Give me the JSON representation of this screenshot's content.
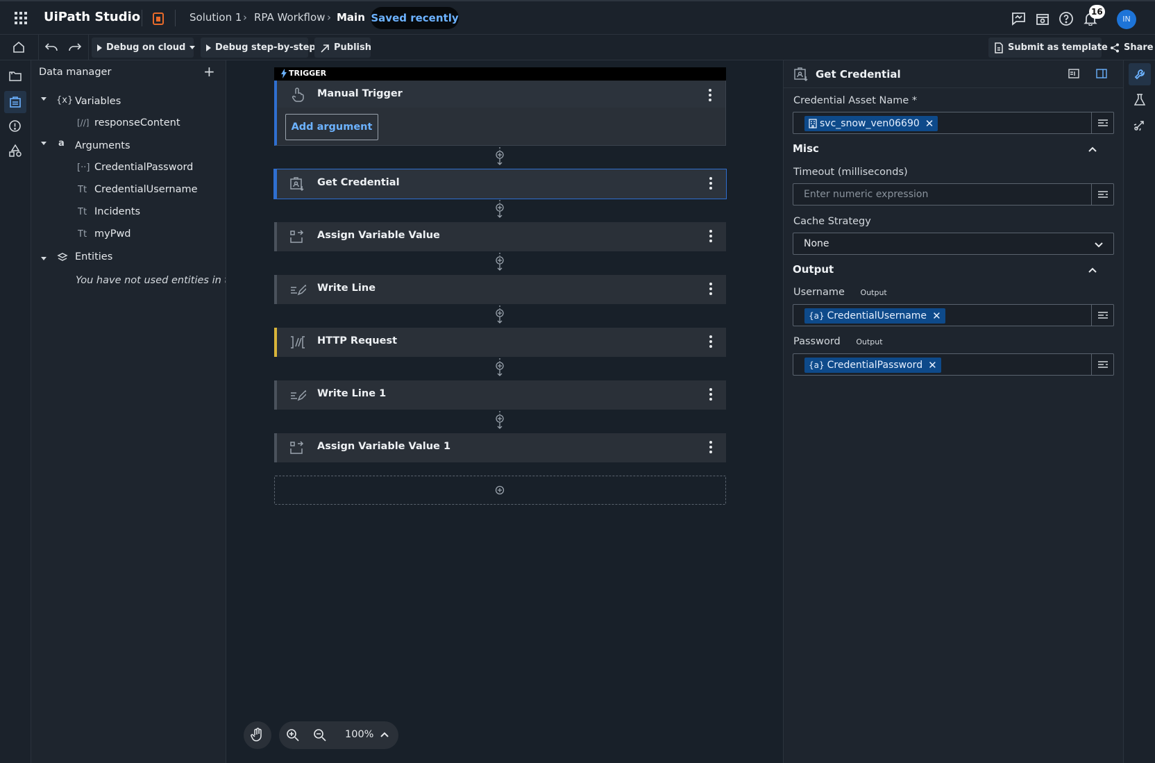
{
  "app": {
    "name": "UiPath Studio"
  },
  "breadcrumb": {
    "solution": "Solution 1",
    "project": "RPA Workflow",
    "file": "Main"
  },
  "status": {
    "saved": "Saved recently"
  },
  "header": {
    "notifications_count": "16",
    "avatar_initials": "IN"
  },
  "toolbar": {
    "debug_cloud": "Debug on cloud",
    "debug_step": "Debug step-by-step",
    "publish": "Publish",
    "submit_template": "Submit as template",
    "share": "Share"
  },
  "data_manager": {
    "title": "Data manager",
    "variables_label": "Variables",
    "variables": [
      "responseContent"
    ],
    "arguments_label": "Arguments",
    "arguments": [
      "CredentialPassword",
      "CredentialUsername",
      "Incidents",
      "myPwd"
    ],
    "entities_label": "Entities",
    "entities_empty": "You have not used entities in th"
  },
  "workflow": {
    "trigger_tag": "TRIGGER",
    "trigger_title": "Manual Trigger",
    "add_argument": "Add argument",
    "activities": [
      "Get Credential",
      "Assign Variable Value",
      "Write Line",
      "HTTP Request",
      "Write Line 1",
      "Assign Variable Value 1"
    ]
  },
  "zoom": {
    "level": "100%"
  },
  "properties": {
    "title": "Get Credential",
    "asset_label": "Credential Asset Name *",
    "asset_value": "svc_snow_ven06690",
    "misc_label": "Misc",
    "timeout_label": "Timeout (milliseconds)",
    "timeout_placeholder": "Enter numeric expression",
    "cache_label": "Cache Strategy",
    "cache_value": "None",
    "output_label": "Output",
    "username_label": "Username",
    "username_tag": "Output",
    "username_value": "CredentialUsername",
    "password_label": "Password",
    "password_tag": "Output",
    "password_value": "CredentialPassword"
  },
  "colors": {
    "accent": "#6cb2ff",
    "chip": "#0e4a8a",
    "http_bar": "#d8b53a",
    "selected_bar": "#2f6fd0"
  }
}
